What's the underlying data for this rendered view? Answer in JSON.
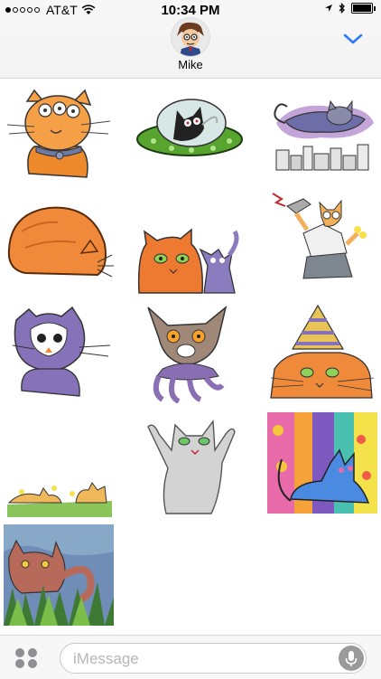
{
  "status_bar": {
    "carrier": "AT&T",
    "time": "10:34 PM"
  },
  "header": {
    "contact_name": "Mike"
  },
  "input": {
    "placeholder": "iMessage"
  },
  "colors": {
    "accent": "#2f7bf5",
    "mic": "#9a9a9a"
  }
}
